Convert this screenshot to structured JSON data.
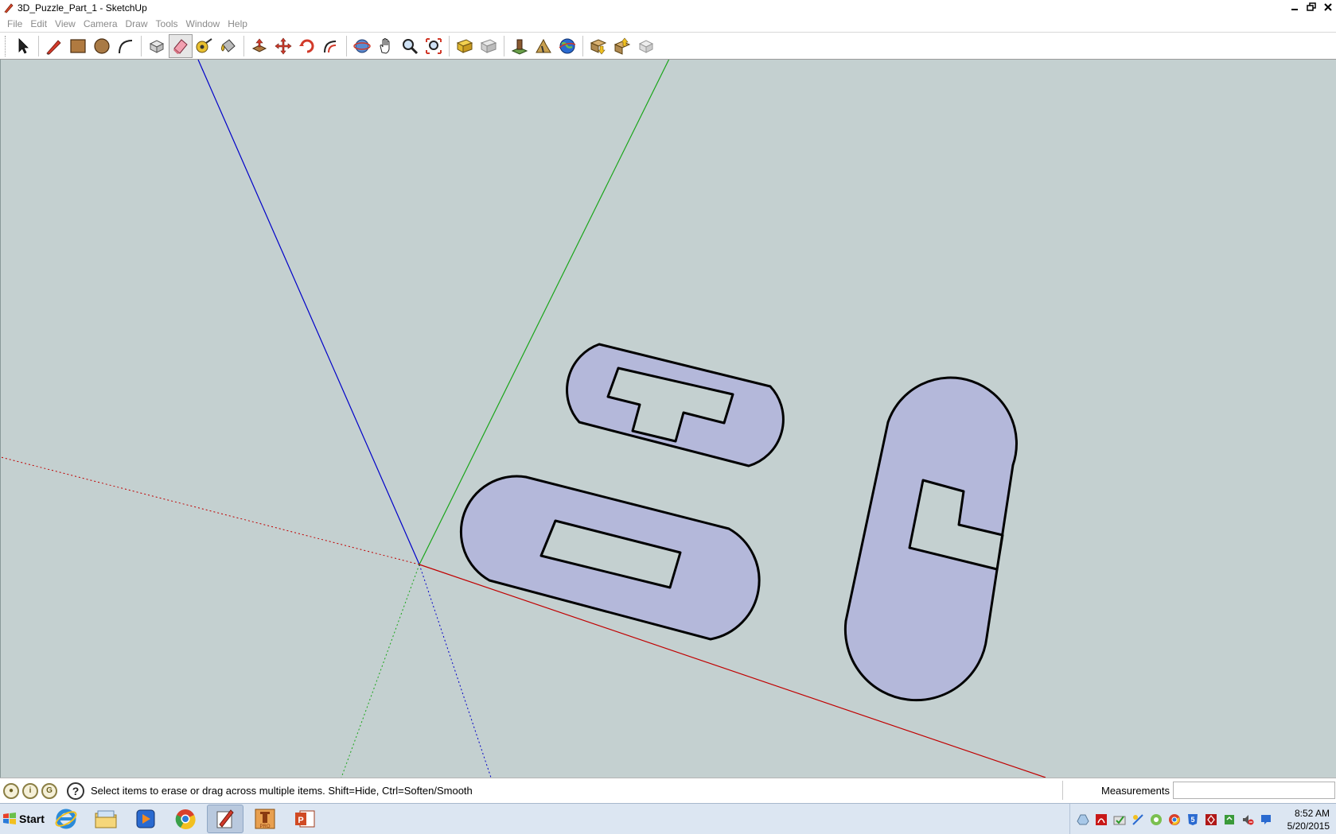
{
  "window": {
    "title": "3D_Puzzle_Part_1 - SketchUp",
    "app_icon": "sketchup-pencil-icon",
    "controls": [
      "minimize-icon",
      "restore-icon",
      "close-icon"
    ]
  },
  "menu": [
    "File",
    "Edit",
    "View",
    "Camera",
    "Draw",
    "Tools",
    "Window",
    "Help"
  ],
  "toolbar": {
    "tools": [
      "select-icon",
      "line-icon",
      "rectangle-icon",
      "circle-icon",
      "arc-icon",
      "make-component-icon",
      "eraser-icon",
      "tape-measure-icon",
      "paint-bucket-icon",
      "push-pull-icon",
      "move-icon",
      "rotate-icon",
      "offset-icon",
      "orbit-icon",
      "pan-icon",
      "zoom-icon",
      "zoom-extents-icon",
      "previous-view-icon",
      "next-view-icon",
      "add-location-icon",
      "toggle-terrain-icon",
      "preview-google-earth-icon",
      "get-models-icon",
      "share-model-icon",
      "share-component-icon"
    ],
    "active_tool": "eraser-icon"
  },
  "viewport": {
    "background": "#c4d0d0",
    "face_color": "#b4b8da",
    "axes": {
      "red": "#c00000",
      "green": "#1aa51a",
      "blue": "#0000c8"
    }
  },
  "status": {
    "hint": "Select items to erase or drag across multiple items. Shift=Hide, Ctrl=Soften/Smooth",
    "measurements_label": "Measurements",
    "measurements_value": ""
  },
  "taskbar": {
    "start_label": "Start",
    "apps": [
      "internet-explorer-icon",
      "file-explorer-icon",
      "media-player-icon",
      "chrome-icon",
      "sketchup-icon",
      "inventor-pro-icon",
      "powerpoint-icon"
    ],
    "active_app": "sketchup-icon",
    "tray_icons": [
      "google-drive-icon",
      "acrobat-icon",
      "checkmark-icon",
      "network-tool-icon",
      "picasa-icon",
      "chrome-tray-icon",
      "html5-icon",
      "security-icon",
      "sync-icon",
      "volume-muted-icon",
      "action-center-icon"
    ],
    "time": "8:52 AM",
    "date": "5/20/2015"
  }
}
